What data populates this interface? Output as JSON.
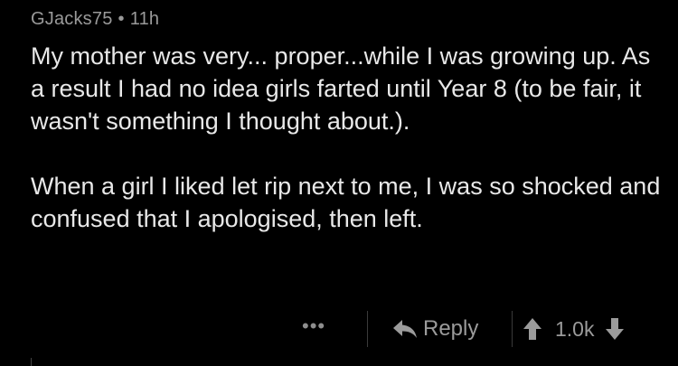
{
  "comment": {
    "author": "GJacks75",
    "separator": "•",
    "time": "11h",
    "paragraphs": [
      "My mother was very... proper...while I was growing up. As a result I had no idea girls farted until Year 8 (to be fair, it wasn't something I thought about.).",
      "When a girl I liked let rip next to me, I was so shocked and confused that I apologised, then left."
    ]
  },
  "actions": {
    "more_label": "•••",
    "reply_label": "Reply",
    "score": "1.0k"
  },
  "icons": {
    "reply": "reply-arrow-icon",
    "upvote": "upvote-arrow-icon",
    "downvote": "downvote-arrow-icon",
    "more": "more-dots-icon"
  },
  "colors": {
    "background": "#000000",
    "text": "#e8e8e8",
    "muted": "#9b9b9b"
  }
}
